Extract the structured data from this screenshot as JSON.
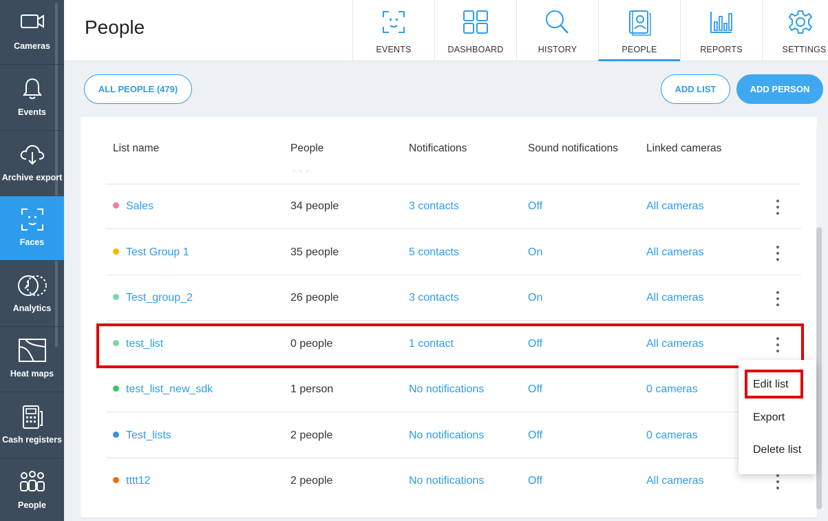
{
  "sidebar": {
    "items": [
      {
        "label": "Cameras",
        "icon": "video-camera-icon",
        "active": false
      },
      {
        "label": "Events",
        "icon": "bell-icon",
        "active": false
      },
      {
        "label": "Archive export",
        "icon": "cloud-download-icon",
        "active": false
      },
      {
        "label": "Faces",
        "icon": "face-scan-icon",
        "active": true
      },
      {
        "label": "Analytics",
        "icon": "analytics-circle-icon",
        "active": false
      },
      {
        "label": "Heat maps",
        "icon": "heat-map-icon",
        "active": false
      },
      {
        "label": "Cash registers",
        "icon": "cash-register-icon",
        "active": false
      },
      {
        "label": "People",
        "icon": "people-group-icon",
        "active": false
      }
    ]
  },
  "header": {
    "title": "People",
    "tabs": [
      {
        "label": "EVENTS",
        "icon": "face-scan-icon"
      },
      {
        "label": "DASHBOARD",
        "icon": "dashboard-grid-icon"
      },
      {
        "label": "HISTORY",
        "icon": "search-icon"
      },
      {
        "label": "PEOPLE",
        "icon": "person-card-icon",
        "active": true
      },
      {
        "label": "REPORTS",
        "icon": "bar-chart-icon"
      },
      {
        "label": "SETTINGS",
        "icon": "gear-icon"
      }
    ]
  },
  "actions": {
    "all_people": "ALL PEOPLE (479)",
    "add_list": "ADD LIST",
    "add_person": "ADD PERSON"
  },
  "table": {
    "columns": [
      "List name",
      "People",
      "Notifications",
      "Sound notifications",
      "Linked cameras"
    ],
    "rows": [
      {
        "name": "Sales",
        "color": "#f07c9a",
        "people": "34 people",
        "notifications": "3 contacts",
        "sound": "Off",
        "cameras": "All cameras"
      },
      {
        "name": "Test Group 1",
        "color": "#f5b800",
        "people": "35 people",
        "notifications": "5 contacts",
        "sound": "On",
        "cameras": "All cameras"
      },
      {
        "name": "Test_group_2",
        "color": "#7ed6a8",
        "people": "26 people",
        "notifications": "3 contacts",
        "sound": "On",
        "cameras": "All cameras"
      },
      {
        "name": "test_list",
        "color": "#7ed6a8",
        "people": "0 people",
        "notifications": "1 contact",
        "sound": "Off",
        "cameras": "All cameras"
      },
      {
        "name": "test_list_new_sdk",
        "color": "#3cc46a",
        "people": "1 person",
        "notifications": "No notifications",
        "sound": "Off",
        "cameras": "0 cameras"
      },
      {
        "name": "Test_lists",
        "color": "#3a8ee6",
        "people": "2 people",
        "notifications": "No notifications",
        "sound": "Off",
        "cameras": "0 cameras"
      },
      {
        "name": "tttt12",
        "color": "#f06a10",
        "people": "2 people",
        "notifications": "No notifications",
        "sound": "Off",
        "cameras": "All cameras"
      }
    ]
  },
  "context_menu": {
    "edit": "Edit list",
    "export": "Export",
    "delete": "Delete list"
  },
  "colors": {
    "accent": "#2e9cec",
    "sidebar_bg": "#3c4c5c",
    "highlight": "#e00000"
  }
}
